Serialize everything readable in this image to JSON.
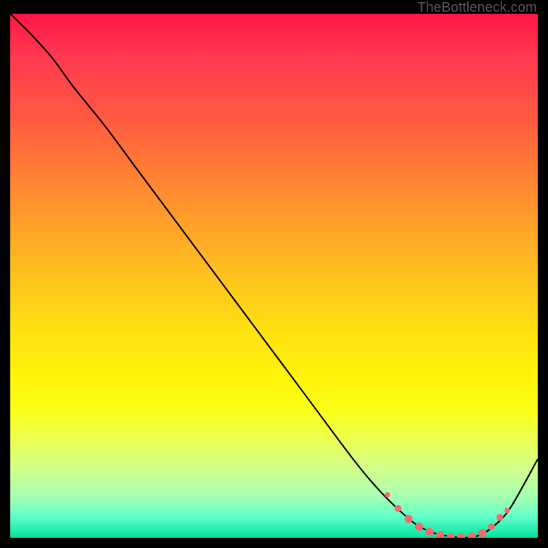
{
  "watermark": "TheBottleneck.com",
  "chart_data": {
    "type": "line",
    "title": "",
    "xlabel": "",
    "ylabel": "",
    "xlim": [
      0,
      100
    ],
    "ylim": [
      0,
      100
    ],
    "grid": false,
    "series": [
      {
        "name": "curve",
        "x": [
          0,
          4,
          8,
          12,
          18,
          25,
          35,
          45,
          55,
          65,
          70,
          74,
          77,
          80,
          83,
          86,
          89,
          92,
          95,
          100
        ],
        "y": [
          100,
          96,
          91.5,
          86,
          78.5,
          69,
          55.5,
          42,
          28.5,
          15,
          9,
          5,
          2.5,
          1,
          0.3,
          0,
          0.5,
          2.5,
          6,
          15
        ]
      }
    ],
    "markers": {
      "name": "dots",
      "points": [
        {
          "x": 71.5,
          "y": 8.2,
          "r": 4
        },
        {
          "x": 73.5,
          "y": 5.6,
          "r": 5
        },
        {
          "x": 75.5,
          "y": 3.6,
          "r": 6
        },
        {
          "x": 77.5,
          "y": 2.1,
          "r": 6
        },
        {
          "x": 79.5,
          "y": 1.1,
          "r": 6
        },
        {
          "x": 81.5,
          "y": 0.5,
          "r": 6
        },
        {
          "x": 83.5,
          "y": 0.15,
          "r": 6
        },
        {
          "x": 85.5,
          "y": 0.05,
          "r": 6
        },
        {
          "x": 87.5,
          "y": 0.25,
          "r": 6
        },
        {
          "x": 89.5,
          "y": 0.9,
          "r": 6
        },
        {
          "x": 91.2,
          "y": 2.1,
          "r": 5
        },
        {
          "x": 92.8,
          "y": 3.9,
          "r": 5
        },
        {
          "x": 94.2,
          "y": 5.2,
          "r": 4
        }
      ]
    },
    "background_gradient": {
      "top": "#ff1744",
      "mid": "#ffd500",
      "bottom": "#00e5a0"
    }
  }
}
